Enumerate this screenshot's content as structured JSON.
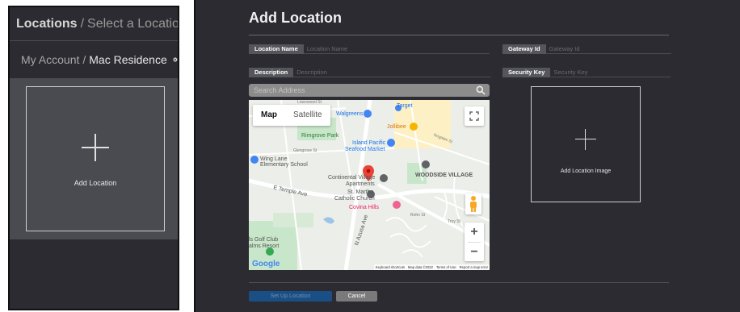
{
  "sidebar": {
    "header": {
      "primary": "Locations",
      "separator": "/",
      "secondary": "Select a Location"
    },
    "account": {
      "primary": "My Account",
      "separator": "/",
      "secondary": "Mac Residence",
      "icon": "gear-icon"
    },
    "add_card": {
      "label": "Add Location",
      "icon": "plus-icon"
    }
  },
  "form": {
    "title": "Add Location",
    "fields": {
      "location_name": {
        "label": "Location Name",
        "placeholder": "Location Name",
        "value": ""
      },
      "gateway_id": {
        "label": "Gateway Id",
        "placeholder": "Gateway Id",
        "value": ""
      },
      "description": {
        "label": "Description",
        "placeholder": "Description",
        "value": ""
      },
      "security_key": {
        "label": "Security Key",
        "placeholder": "Security Key",
        "value": ""
      }
    },
    "search": {
      "placeholder": "Search Address",
      "icon": "search-icon"
    },
    "map": {
      "type_map": "Map",
      "type_satellite": "Satellite",
      "labels": {
        "target": "Target",
        "walgreens": "Walgreens",
        "jollibee": "Jollibee",
        "rimgrove_park": "Rimgrove Park",
        "island_pacific_1": "Island Pacific",
        "island_pacific_2": "Seafood Market",
        "wing_lane_1": "Wing Lane",
        "wing_lane_2": "Elementary School",
        "continental_1": "Continental Village",
        "continental_2": "Apartments",
        "st_martha_1": "St. Martha",
        "st_martha_2": "Catholic Church",
        "covina_hills": "Covina Hills",
        "woodside_village": "WOODSIDE VILLAGE",
        "golf_1": "ls Golf Club",
        "golf_2": "alms Resort",
        "temple_ave": "E Temple Ave",
        "azusa_ave": "N Azusa Ave",
        "lownwood_st": "Lownwood St",
        "glengrove_st": "Glengrove St",
        "nogales_st": "Nogales St",
        "rohn_st": "Rohn St",
        "troy_st": "Troy St",
        "google": "Google"
      },
      "attribution": {
        "shortcuts": "Keyboard shortcuts",
        "map_data": "Map data ©2022",
        "terms": "Terms of Use",
        "report": "Report a map error"
      },
      "colors": {
        "water": "#9dc3e6",
        "park": "#c8e6c9",
        "commercial": "#fdf0c4",
        "road": "#ffffff"
      }
    },
    "image_drop": {
      "label": "Add Location Image",
      "icon": "plus-icon"
    },
    "buttons": {
      "setup": "Set Up Location",
      "cancel": "Cancel"
    }
  },
  "colors": {
    "panel_bg": "#2b2b31",
    "card_area_bg": "#4a4a51",
    "field_label_bg": "#55555c",
    "primary_button": "#1a4f86",
    "secondary_button": "#7a7a7a"
  }
}
